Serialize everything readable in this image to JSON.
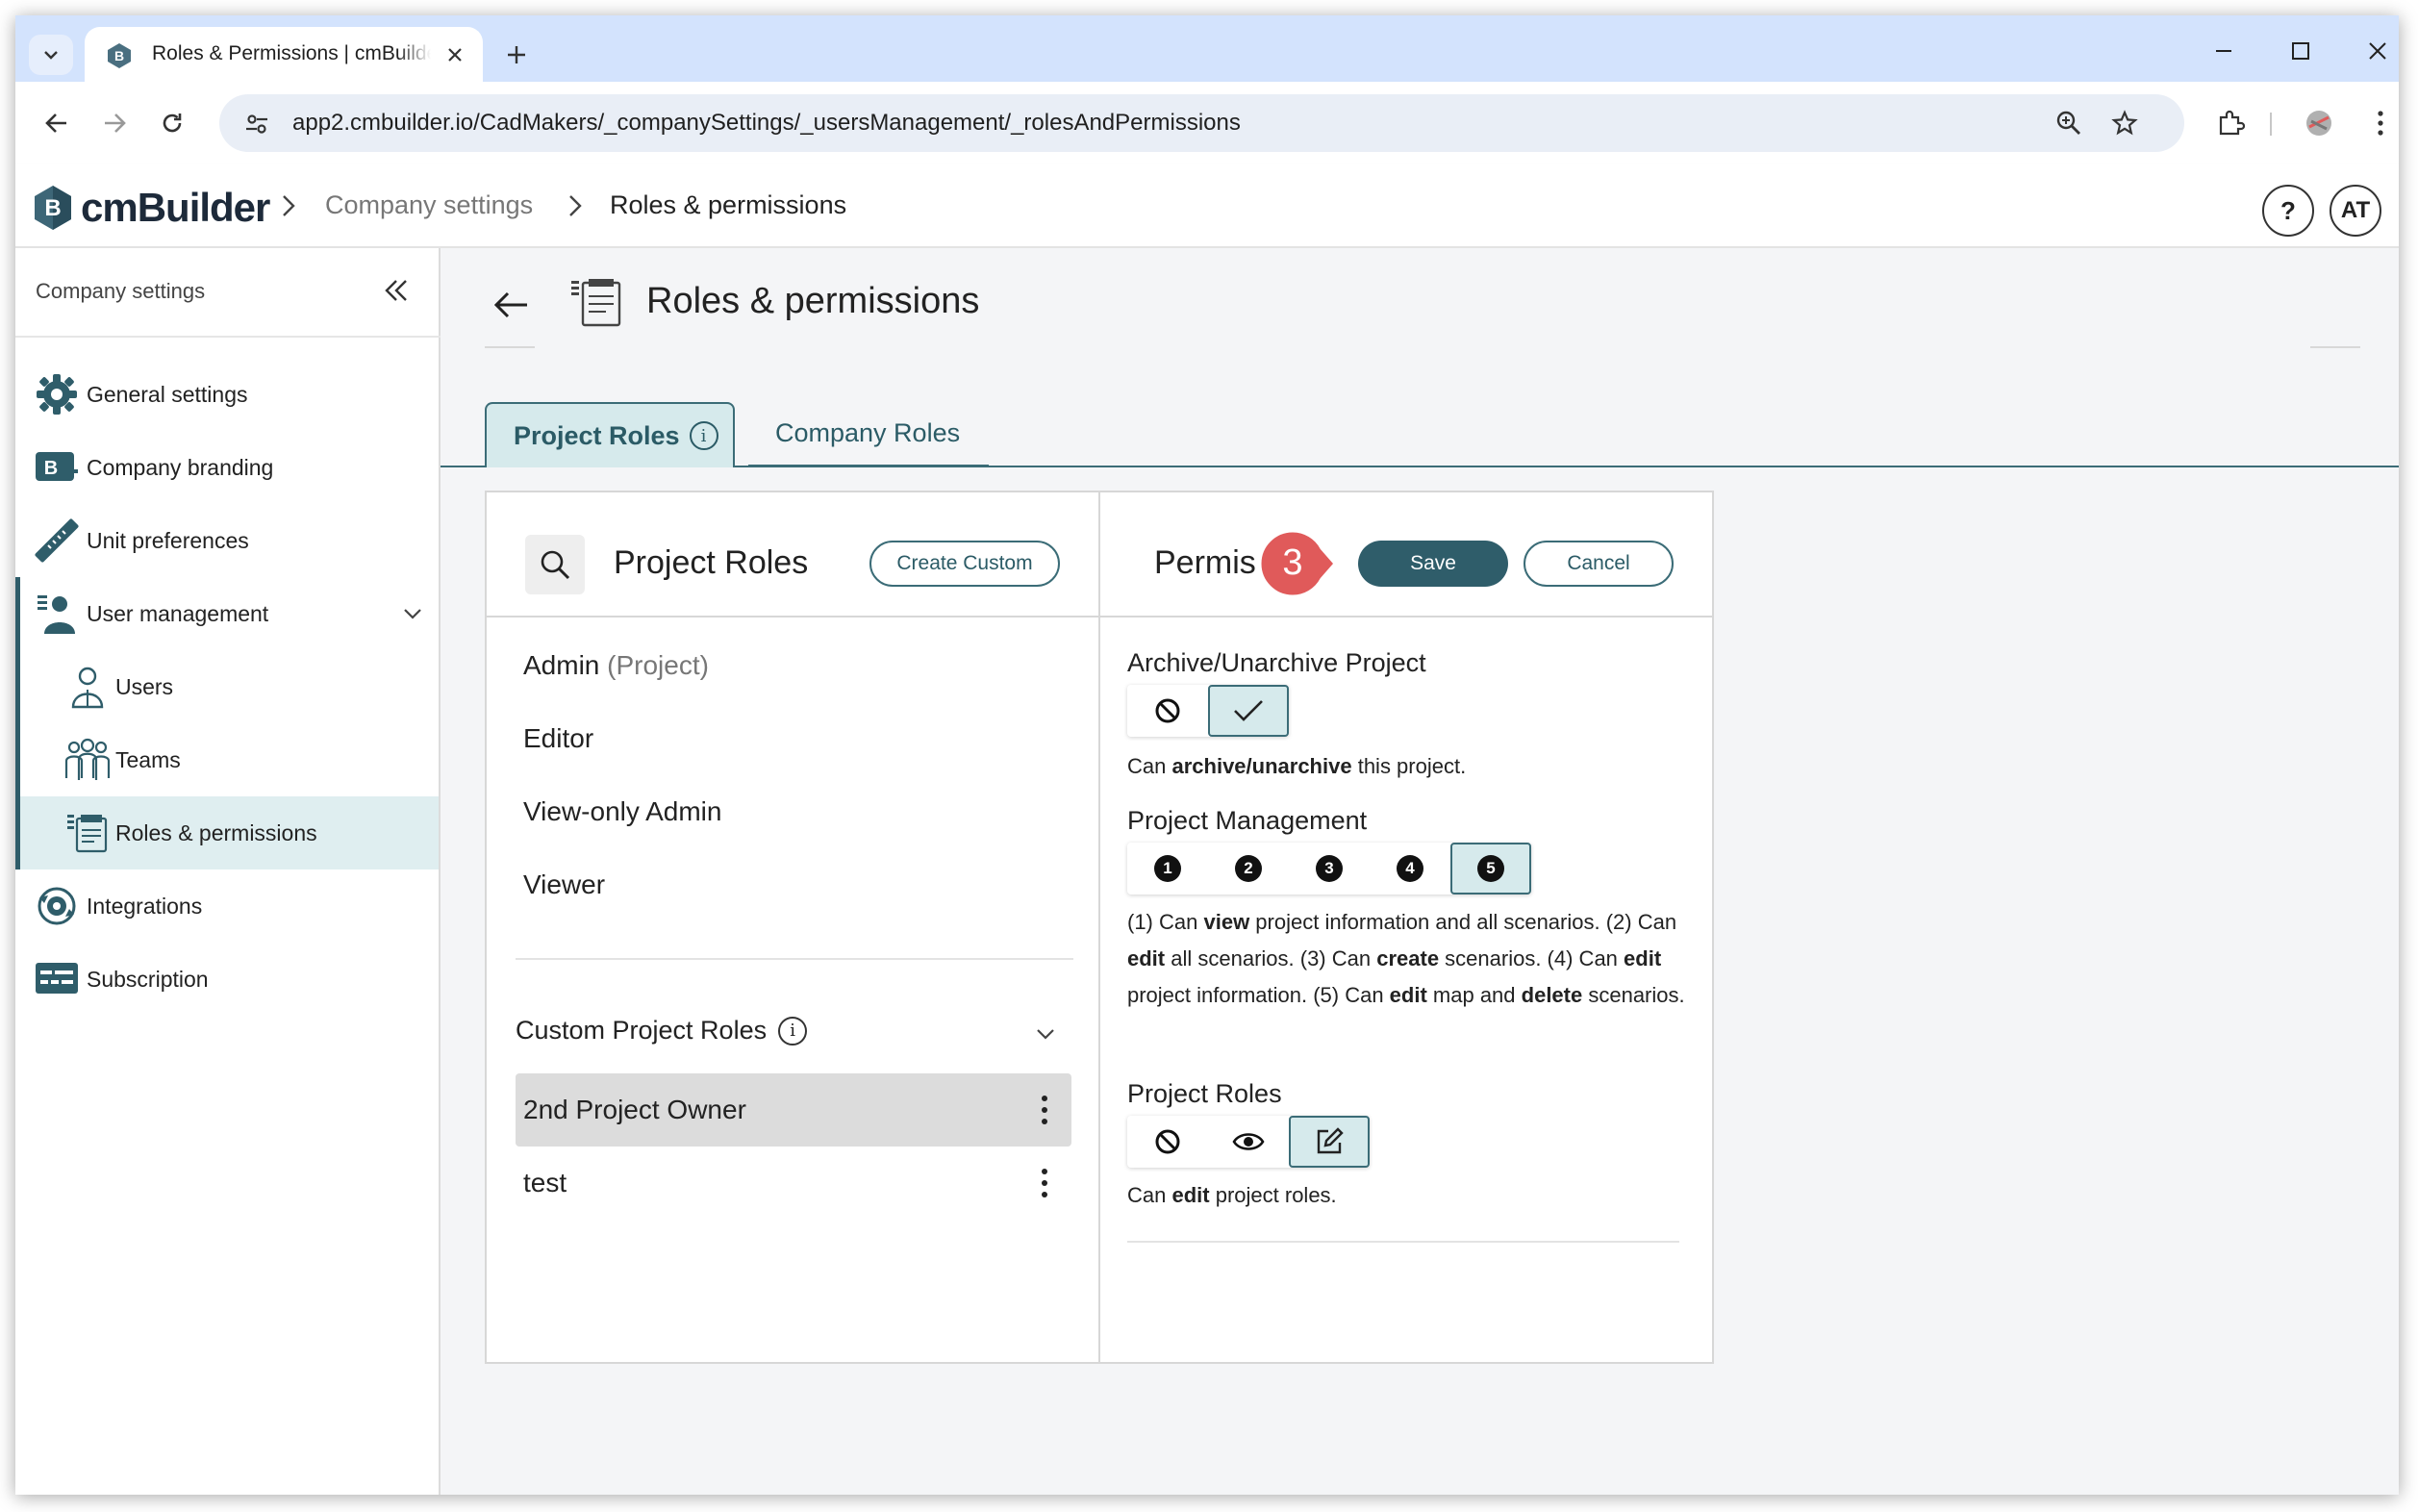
{
  "browser": {
    "tab_title": "Roles & Permissions | cmBuilder",
    "url": "app2.cmbuilder.io/CadMakers/_companySettings/_usersManagement/_rolesAndPermissions"
  },
  "header": {
    "logo_text": "cmBuilder",
    "breadcrumb": [
      "Company settings",
      "Roles & permissions"
    ],
    "help_label": "?",
    "avatar_initials": "AT"
  },
  "sidebar": {
    "title": "Company settings",
    "items": [
      {
        "label": "General settings",
        "icon": "gear-icon"
      },
      {
        "label": "Company branding",
        "icon": "branding-icon"
      },
      {
        "label": "Unit preferences",
        "icon": "ruler-icon"
      },
      {
        "label": "User management",
        "icon": "user-management-icon"
      },
      {
        "label": "Users",
        "icon": "user-icon"
      },
      {
        "label": "Teams",
        "icon": "teams-icon"
      },
      {
        "label": "Roles & permissions",
        "icon": "roles-icon"
      },
      {
        "label": "Integrations",
        "icon": "integrations-icon"
      },
      {
        "label": "Subscription",
        "icon": "subscription-icon"
      }
    ],
    "active": "Roles & permissions"
  },
  "main": {
    "page_title": "Roles & permissions",
    "tabs": [
      {
        "label": "Project Roles",
        "active": true
      },
      {
        "label": "Company Roles",
        "active": false
      }
    ],
    "roles_panel": {
      "title": "Project Roles",
      "create_label": "Create Custom",
      "roles": [
        {
          "name": "Admin",
          "suffix": "(Project)"
        },
        {
          "name": "Editor",
          "suffix": ""
        },
        {
          "name": "View-only Admin",
          "suffix": ""
        },
        {
          "name": "Viewer",
          "suffix": ""
        }
      ],
      "custom_header": "Custom Project Roles",
      "custom_roles": [
        {
          "name": "2nd Project Owner",
          "selected": true
        },
        {
          "name": "test",
          "selected": false
        }
      ]
    },
    "perm_panel": {
      "title": "Permis",
      "save_label": "Save",
      "cancel_label": "Cancel",
      "step_number": "3",
      "sections": [
        {
          "title": "Archive/Unarchive Project",
          "options": [
            "deny-icon",
            "check-icon"
          ],
          "selected": 1,
          "description_parts": [
            [
              "Can ",
              false
            ],
            [
              "archive/unarchive",
              true
            ],
            [
              " this project.",
              false
            ]
          ]
        },
        {
          "title": "Project Management",
          "options": [
            "1",
            "2",
            "3",
            "4",
            "5"
          ],
          "selected": 4,
          "description_parts": [
            [
              "(1) Can ",
              false
            ],
            [
              "view",
              true
            ],
            [
              " project information and all scenarios. (2) Can ",
              false
            ],
            [
              "edit",
              true
            ],
            [
              " all scenarios. (3) Can ",
              false
            ],
            [
              "create",
              true
            ],
            [
              " scenarios. (4) Can ",
              false
            ],
            [
              "edit",
              true
            ],
            [
              " project information. (5) Can ",
              false
            ],
            [
              "edit",
              true
            ],
            [
              " map and ",
              false
            ],
            [
              "delete",
              true
            ],
            [
              " scenarios.",
              false
            ]
          ]
        },
        {
          "title": "Project Roles",
          "options": [
            "deny-icon",
            "eye-icon",
            "edit-icon"
          ],
          "selected": 2,
          "description_parts": [
            [
              "Can ",
              false
            ],
            [
              "edit",
              true
            ],
            [
              " project roles.",
              false
            ]
          ]
        }
      ]
    }
  },
  "colors": {
    "accent": "#2f5d6a",
    "accent_light": "#d6eaec",
    "marker": "#e05a5a",
    "tabstrip": "#d3e3fd"
  }
}
